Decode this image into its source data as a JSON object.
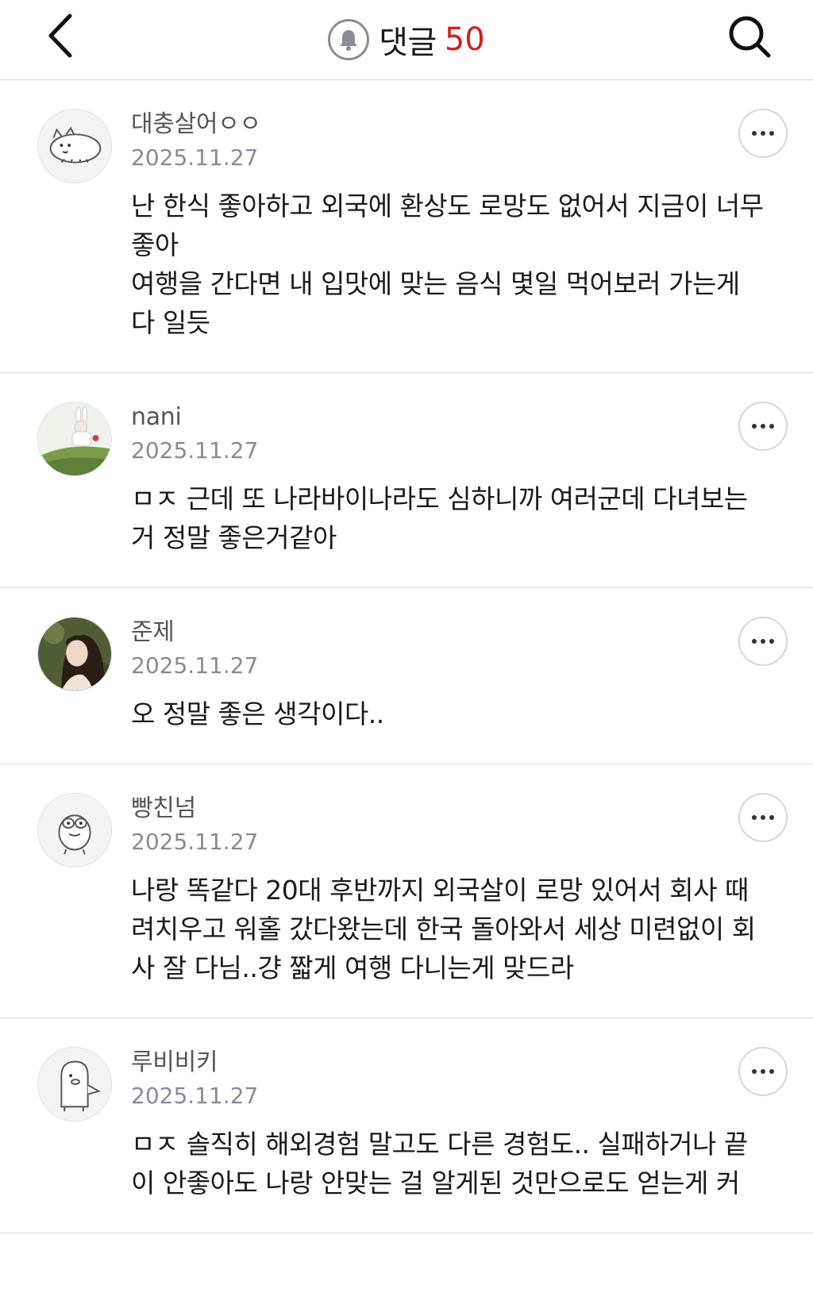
{
  "header": {
    "back_icon": "chevron-left-icon",
    "bell_icon": "bell-icon",
    "title": "댓글",
    "count": "50",
    "search_icon": "search-icon",
    "count_color": "#d32020"
  },
  "comments": [
    {
      "username": "대충살어ㅇㅇ",
      "date": "2025.11.27",
      "avatar_icon": "cat-doodle-avatar",
      "body": "난 한식 좋아하고 외국에 환상도 로망도 없어서 지금이 너무 좋아\n여행을 간다면 내 입맛에 맞는 음식 몇일 먹어보러 가는게 다 일듯",
      "more_icon": "more-icon"
    },
    {
      "username": "nani",
      "date": "2025.11.27",
      "avatar_icon": "bunny-costume-photo-avatar",
      "body": "ㅁㅈ 근데 또 나라바이나라도 심하니까 여러군데 다녀보는거 정말 좋은거같아",
      "more_icon": "more-icon"
    },
    {
      "username": "준제",
      "date": "2025.11.27",
      "avatar_icon": "woman-portrait-avatar",
      "body": "오 정말 좋은 생각이다..",
      "more_icon": "more-icon"
    },
    {
      "username": "빵친넘",
      "date": "2025.11.27",
      "avatar_icon": "frog-doodle-avatar",
      "body": "나랑 똑같다 20대 후반까지 외국살이 로망 있어서  회사 때려치우고 워홀 갔다왔는데 한국 돌아와서 세상 미련없이 회사 잘 다님..걍 짧게 여행 다니는게 맞드라",
      "more_icon": "more-icon"
    },
    {
      "username": "루비비키",
      "date": "2025.11.27",
      "avatar_icon": "penguin-doodle-avatar",
      "body": "ㅁㅈ 솔직히 해외경험 말고도 다른 경험도.. 실패하거나 끝이 안좋아도 나랑 안맞는 걸 알게된 것만으로도 얻는게 커",
      "more_icon": "more-icon"
    }
  ]
}
